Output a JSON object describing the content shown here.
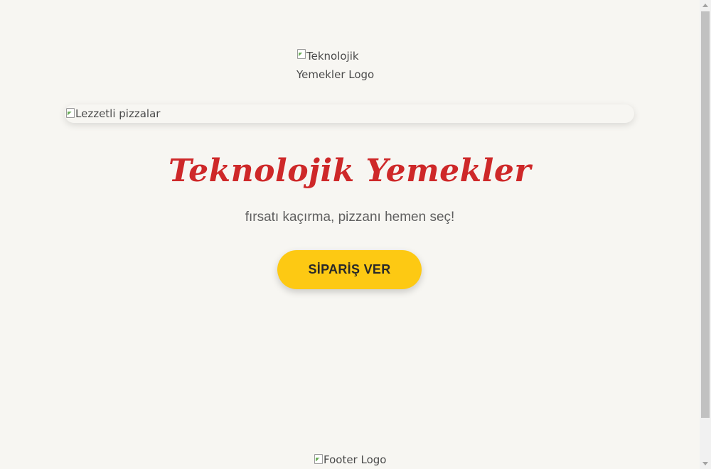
{
  "header": {
    "logo_alt_line1": "Teknolojik",
    "logo_alt_line2": "Yemekler Logo"
  },
  "hero": {
    "image_alt": "Lezzetli pizzalar",
    "title": "Teknolojik Yemekler",
    "subtitle": "fırsatı kaçırma, pizzanı hemen seç!",
    "cta_label": "SİPARİŞ VER"
  },
  "footer": {
    "logo_alt": "Footer Logo"
  },
  "colors": {
    "background": "#f7f6f2",
    "title_red": "#ce2829",
    "cta_yellow": "#fdc913",
    "text_dark": "#292929"
  }
}
